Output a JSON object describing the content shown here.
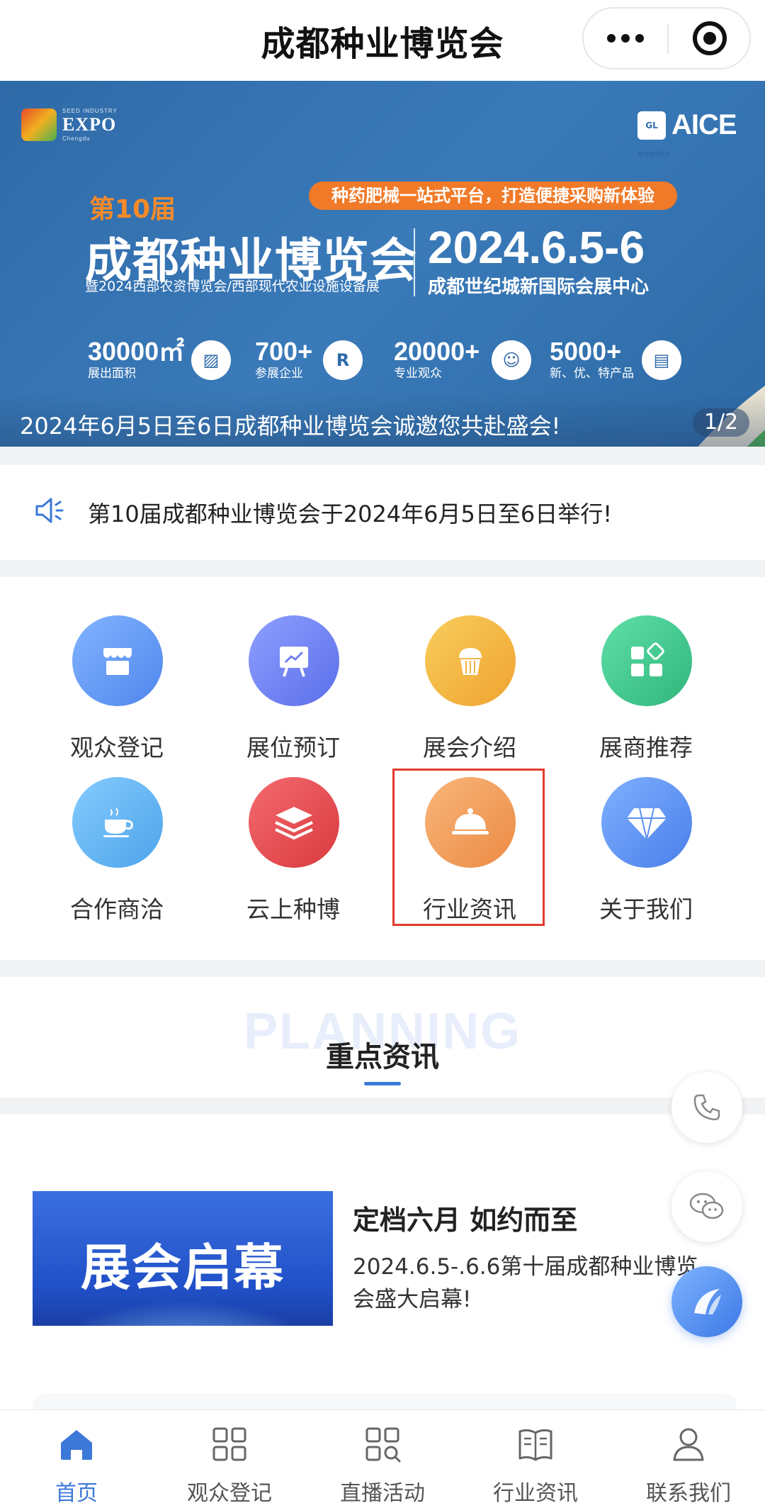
{
  "titlebar": {
    "title": "成都种业博览会",
    "icons": [
      "more-icon",
      "close-target-icon"
    ]
  },
  "banner": {
    "logo_text": "EXPO",
    "logo_small": "SEED INDUSTRY",
    "logo_city": "Chengdu",
    "organizer_badge": "GL events",
    "organizer_text": "AICE",
    "tagline": "种药肥械一站式平台，打造便捷采购新体验",
    "edition": "第10届",
    "title": "成都种业博览会",
    "subtitle": "暨2024西部农资博览会/西部现代农业设施设备展",
    "date": "2024.6.5-6",
    "venue": "成都世纪城新国际会展中心",
    "stats": [
      {
        "num": "30000㎡",
        "label": "展出面积",
        "icon": "area-icon"
      },
      {
        "num": "700+",
        "label": "参展企业",
        "icon": "registered-icon"
      },
      {
        "num": "20000+",
        "label": "专业观众",
        "icon": "visitor-icon"
      },
      {
        "num": "5000+",
        "label": "新、优、特产品",
        "icon": "product-icon"
      }
    ],
    "caption": "2024年6月5日至6日成都种业博览会诚邀您共赴盛会!",
    "pager": "1/2"
  },
  "notice": {
    "text": "第10届成都种业博览会于2024年6月5日至6日举行!",
    "icon": "speaker-icon"
  },
  "grid": {
    "items": [
      {
        "label": "观众登记",
        "icon": "store-icon",
        "color": "#5f95f2"
      },
      {
        "label": "展位预订",
        "icon": "presentation-chart-icon",
        "color": "#6f7ff0"
      },
      {
        "label": "展会介绍",
        "icon": "cupcake-icon",
        "color": "#f3b240"
      },
      {
        "label": "展商推荐",
        "icon": "apps-icon",
        "color": "#39c08a"
      },
      {
        "label": "合作商洽",
        "icon": "coffee-icon",
        "color": "#5fb3ef"
      },
      {
        "label": "云上种博",
        "icon": "layers-icon",
        "color": "#e5484d"
      },
      {
        "label": "行业资讯",
        "icon": "cloche-icon",
        "color": "#f19852"
      },
      {
        "label": "关于我们",
        "icon": "diamond-icon",
        "color": "#5a8ff0"
      }
    ],
    "highlight_color": "#e23b2e"
  },
  "section": {
    "bg_text": "PLANNING",
    "title": "重点资讯",
    "accent": "#3c78d8"
  },
  "news": {
    "items": [
      {
        "thumb_text": "展会启幕",
        "title": "定档六月 如约而至",
        "desc": "2024.6.5-.6.6第十届成都种业博览会盛大启幕!"
      }
    ]
  },
  "floating": [
    "phone-icon",
    "wechat-icon",
    "ai-assistant-icon"
  ],
  "tabbar": {
    "tabs": [
      {
        "label": "首页",
        "icon": "home-icon",
        "active": true
      },
      {
        "label": "观众登记",
        "icon": "grid-icon",
        "active": false
      },
      {
        "label": "直播活动",
        "icon": "grid-search-icon",
        "active": false
      },
      {
        "label": "行业资讯",
        "icon": "book-icon",
        "active": false
      },
      {
        "label": "联系我们",
        "icon": "user-icon",
        "active": false
      }
    ],
    "active_color": "#3c78d8"
  }
}
